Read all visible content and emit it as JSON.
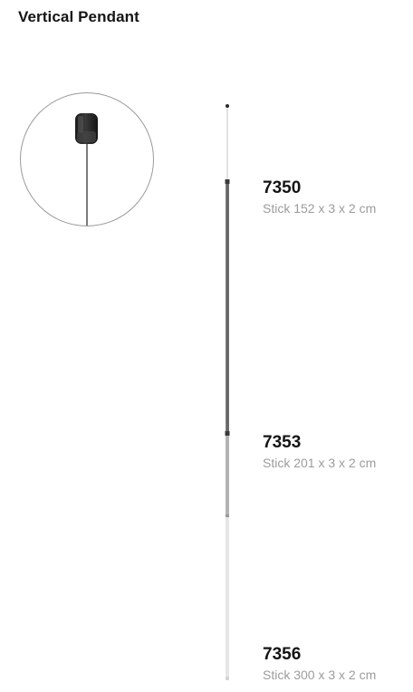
{
  "page": {
    "title": "Vertical Pendant"
  },
  "products": [
    {
      "code": "7350",
      "description": "Stick 152 x 3 x 2 cm"
    },
    {
      "code": "7353",
      "description": "Stick 201 x 3 x 2 cm"
    },
    {
      "code": "7356",
      "description": "Stick 300 x 3 x 2 cm"
    }
  ],
  "colors": {
    "stick_dark": "#6e6e6e",
    "stick_mid": "#a9a9a9",
    "stick_light": "#e4e4e4",
    "circle_border": "#9a9a9a"
  }
}
